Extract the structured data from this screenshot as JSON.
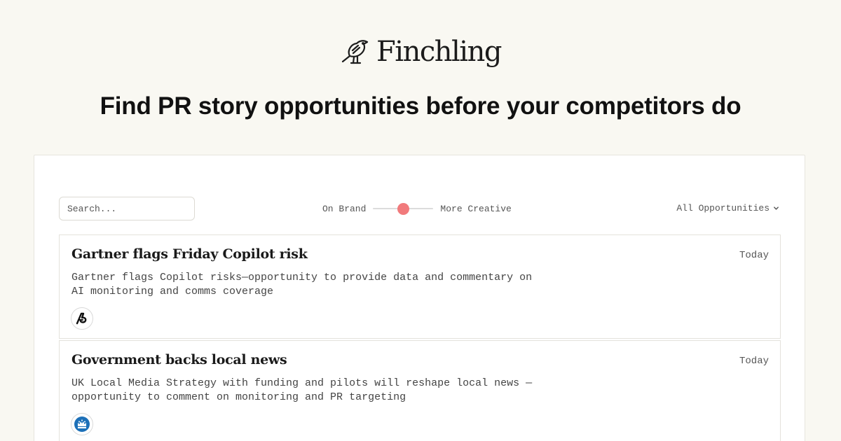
{
  "brand": {
    "name": "Finchling",
    "logo_icon": "finch-bird-icon"
  },
  "headline": "Find PR story opportunities before your competitors do",
  "controls": {
    "search_placeholder": "Search...",
    "slider": {
      "left_label": "On Brand",
      "right_label": "More Creative",
      "value": 0.5,
      "accent_color": "#f17a7c"
    },
    "filter_label": "All Opportunities",
    "filter_icon": "chevron-down-icon"
  },
  "opportunities": [
    {
      "title": "Gartner flags Friday Copilot risk",
      "date": "Today",
      "description": "Gartner flags Copilot risks—opportunity to provide data and commentary on AI monitoring and comms coverage",
      "source_icon": "news-source-logo-icon"
    },
    {
      "title": "Government backs local news",
      "date": "Today",
      "description": "UK Local Media Strategy with funding and pilots will reshape local news — opportunity to comment on monitoring and PR targeting",
      "source_icon": "uk-government-crest-icon"
    }
  ],
  "colors": {
    "background": "#f9f8f2",
    "card": "#ffffff",
    "accent": "#f17a7c",
    "gov_blue": "#1d70b8"
  }
}
